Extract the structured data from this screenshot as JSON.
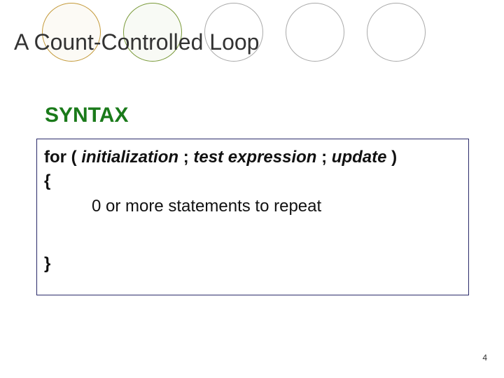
{
  "title": "A Count-Controlled Loop",
  "syntax_label": "SYNTAX",
  "code": {
    "kw_for": "for",
    "paren_open": "(",
    "init": "initialization",
    "semi1": ";",
    "test": "test expression",
    "semi2": ";",
    "update": "update",
    "paren_close": ")",
    "brace_open": "{",
    "body": "0 or more statements to repeat",
    "brace_close": "}"
  },
  "page_number": "4"
}
